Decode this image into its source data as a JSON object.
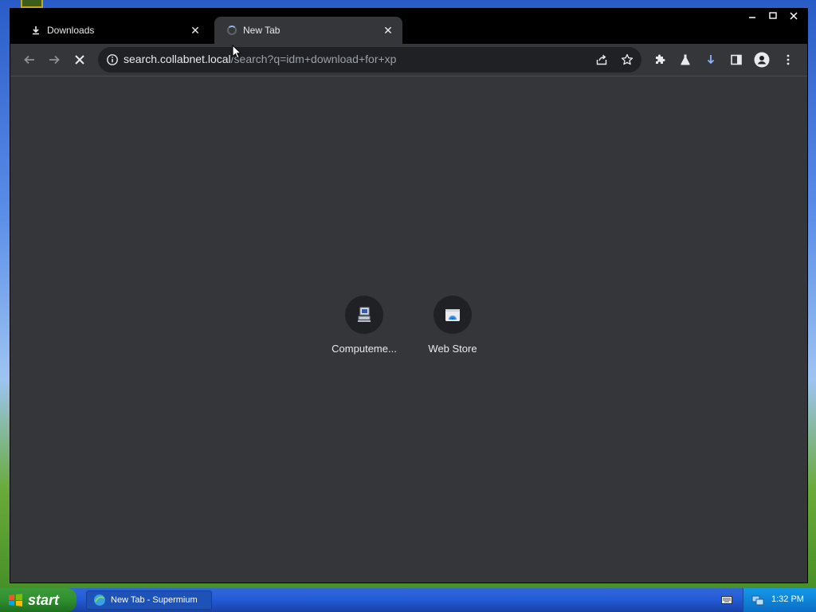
{
  "browser": {
    "tabs": [
      {
        "title": "Downloads",
        "icon": "download-icon"
      },
      {
        "title": "New Tab",
        "icon": "loading-spinner-icon",
        "active": true
      }
    ],
    "url_host": "search.collabnet.local",
    "url_rest": "/search?q=idm+download+for+xp",
    "loading": true
  },
  "shortcuts": [
    {
      "label": "Computeme...",
      "icon": "computer-icon"
    },
    {
      "label": "Web Store",
      "icon": "web-store-icon"
    }
  ],
  "taskbar": {
    "start_label": "start",
    "task_label": "New Tab - Supermium",
    "clock": "1:32 PM"
  },
  "colors": {
    "accent": "#8ab4f8",
    "toolbar_bg": "#35363a",
    "titlebar_bg": "#000000"
  }
}
